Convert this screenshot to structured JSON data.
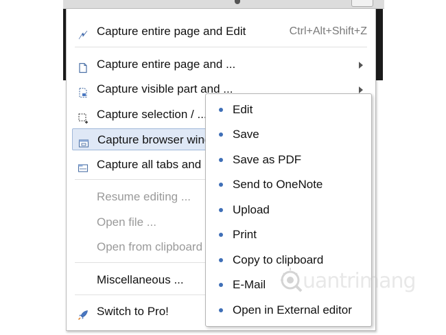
{
  "menu": {
    "items": [
      {
        "label": "Capture entire page and Edit",
        "shortcut": "Ctrl+Alt+Shift+Z",
        "icon": "lightning-icon"
      },
      {
        "label": "Capture entire page and ...",
        "icon": "page-icon"
      },
      {
        "label": "Capture visible part and ...",
        "icon": "visible-part-icon"
      },
      {
        "label": "Capture selection / ...",
        "icon": "selection-icon"
      },
      {
        "label": "Capture browser window",
        "icon": "window-icon"
      },
      {
        "label": "Capture all tabs and ...",
        "icon": "tabs-icon"
      },
      {
        "label": "Resume editing ..."
      },
      {
        "label": "Open file ..."
      },
      {
        "label": "Open from clipboard"
      },
      {
        "label": "Miscellaneous ..."
      },
      {
        "label": "Switch to Pro!",
        "icon": "rocket-icon"
      }
    ]
  },
  "submenu": {
    "items": [
      {
        "label": "Edit"
      },
      {
        "label": "Save"
      },
      {
        "label": "Save as PDF"
      },
      {
        "label": "Send to OneNote"
      },
      {
        "label": "Upload"
      },
      {
        "label": "Print"
      },
      {
        "label": "Copy to clipboard"
      },
      {
        "label": "E-Mail"
      },
      {
        "label": "Open in External editor"
      }
    ]
  },
  "watermark": {
    "text": "uantrimang"
  },
  "colors": {
    "highlight": "#dfe8f6",
    "bullet": "#3f6fb7",
    "disabled": "#9a9a9a",
    "shortcut": "#7a7a7a"
  }
}
